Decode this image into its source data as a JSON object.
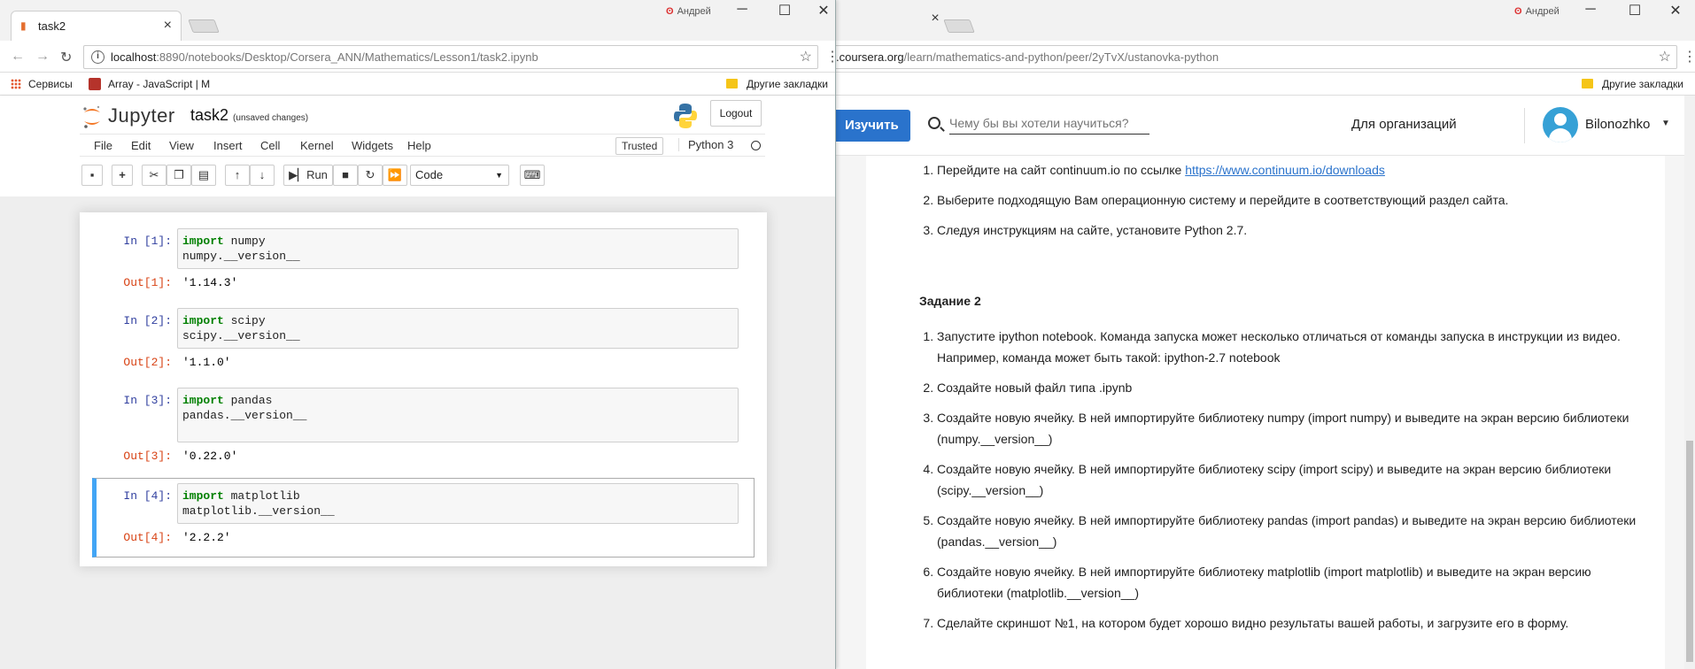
{
  "left_window": {
    "tab_title": "task2",
    "profile_name": "Андрей",
    "url_host": "localhost",
    "url_rest": ":8890/notebooks/Desktop/Corsera_ANN/Mathematics/Lesson1/task2.ipynb",
    "bookmarks": [
      {
        "label": "Сервисы",
        "icon": "apps-icon"
      },
      {
        "label": "Array - JavaScript | M",
        "icon": "mdn-icon"
      }
    ],
    "other_bookmarks": "Другие закладки"
  },
  "jupyter": {
    "logo_text": "Jupyter",
    "notebook_name": "task2",
    "save_status": "(unsaved changes)",
    "logout_label": "Logout",
    "menu": [
      "File",
      "Edit",
      "View",
      "Insert",
      "Cell",
      "Kernel",
      "Widgets",
      "Help"
    ],
    "trusted_label": "Trusted",
    "kernel_name": "Python 3",
    "toolbar": {
      "run_label": "Run",
      "cell_type": "Code"
    },
    "cells": [
      {
        "in_prompt": "In [1]:",
        "line1_kw": "import",
        "line1_rest": " numpy",
        "line2": "numpy.__version__",
        "out_prompt": "Out[1]:",
        "output": "'1.14.3'"
      },
      {
        "in_prompt": "In [2]:",
        "line1_kw": "import",
        "line1_rest": " scipy",
        "line2": "scipy.__version__",
        "out_prompt": "Out[2]:",
        "output": "'1.1.0'"
      },
      {
        "in_prompt": "In [3]:",
        "line1_kw": "import",
        "line1_rest": " pandas",
        "line2": "pandas.__version__",
        "out_prompt": "Out[3]:",
        "output": "'0.22.0'"
      },
      {
        "in_prompt": "In [4]:",
        "line1_kw": "import",
        "line1_rest": " matplotlib",
        "line2": "matplotlib.__version__",
        "out_prompt": "Out[4]:",
        "output": "'2.2.2'"
      }
    ]
  },
  "right_window": {
    "profile_name": "Андрей",
    "url_host": ".coursera.org",
    "url_rest": "/learn/mathematics-and-python/peer/2yTvX/ustanovka-python",
    "other_bookmarks": "Другие закладки"
  },
  "coursera": {
    "learn_button": "Изучить",
    "search_placeholder": "Чему бы вы хотели научиться?",
    "for_business": "Для организаций",
    "user_name": "Bilonozhko",
    "list1": [
      {
        "text": "Перейдите на сайт continuum.io по ссылке ",
        "link": "https://www.continuum.io/downloads"
      },
      {
        "text": "Выберите подходящую Вам операционную систему и перейдите в соответствующий раздел сайта."
      },
      {
        "text": "Следуя инструкциям на сайте, установите Python 2.7."
      }
    ],
    "task_heading": "Задание 2",
    "list2": [
      "Запустите ipython notebook. Команда запуска может несколько отличаться от команды запуска в инструкции из видео. Например, команда может быть такой: ipython-2.7 notebook",
      "Создайте новый файл типа .ipynb",
      "Создайте новую ячейку. В ней импортируйте библиотеку numpy (import numpy) и выведите на экран версию библиотеки (numpy.__version__)",
      "Создайте новую ячейку. В ней импортируйте библиотеку scipy (import scipy) и выведите на экран версию библиотеки (scipy.__version__)",
      "Создайте новую ячейку. В ней импортируйте библиотеку pandas (import pandas) и выведите на экран версию библиотеки (pandas.__version__)",
      "Создайте новую ячейку. В ней импортируйте библиотеку matplotlib (import matplotlib) и выведите на экран версию библиотеки (matplotlib.__version__)",
      "Сделайте скриншот №1, на котором будет хорошо видно результаты вашей работы, и загрузите его в форму."
    ]
  },
  "colors": {
    "jupyter_orange": "#f37726",
    "coursera_blue": "#2a73cc",
    "prompt_in": "#303f9f",
    "prompt_out": "#d84315",
    "selected_cell": "#42a5f5"
  }
}
